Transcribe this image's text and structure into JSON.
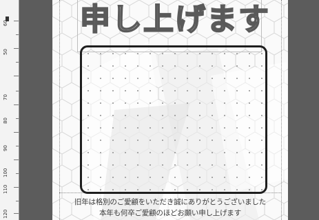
{
  "ruler": {
    "labels": [
      "60",
      "50",
      "70",
      "80",
      "90",
      "100",
      "110",
      "120"
    ]
  },
  "card": {
    "title": "申し上げます",
    "message_line1": "旧年は格別のご愛顧をいただき誠にありがとうございました",
    "message_line2": "本年も何卒ご愛顧のほどお願い申し上げます"
  },
  "colors": {
    "workspace": "#5c5c5c",
    "page": "#fafafa",
    "frame_border": "#1e1e1e"
  }
}
